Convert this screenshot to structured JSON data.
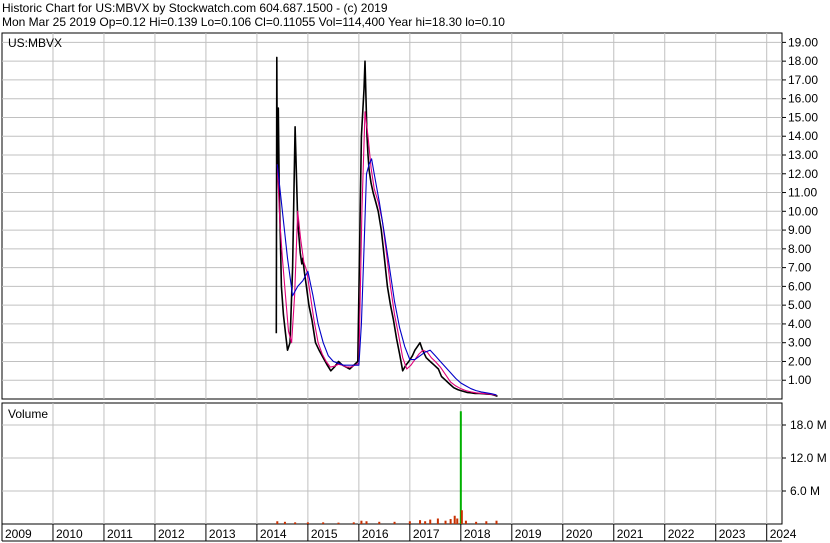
{
  "header": {
    "line1": "Historic Chart for US:MBVX by Stockwatch.com 604.687.1500 - (c) 2019",
    "line2": "Mon Mar 25 2019   Op=0.12  Hi=0.139  Lo=0.106  Cl=0.11055  Vol=114,400  Year hi=18.30  lo=0.10"
  },
  "chart_data": [
    {
      "type": "line",
      "title": "US:MBVX",
      "grid": true,
      "ylim": [
        0,
        19.5
      ],
      "y_ticks": [
        "1.00",
        "2.00",
        "3.00",
        "4.00",
        "5.00",
        "6.00",
        "7.00",
        "8.00",
        "9.00",
        "10.00",
        "11.00",
        "12.00",
        "13.00",
        "14.00",
        "15.00",
        "16.00",
        "17.00",
        "18.00",
        "19.00"
      ],
      "x_ticks": [
        "2009",
        "2010",
        "2011",
        "2012",
        "2013",
        "2014",
        "2015",
        "2016",
        "2017",
        "2018",
        "2019",
        "2020",
        "2021",
        "2022",
        "2023",
        "2024"
      ],
      "xlim": [
        2009.0,
        2024.3
      ],
      "colors": {
        "price": "#000000",
        "short_ma": "#e0007a",
        "long_ma": "#0000c8",
        "grid": "#c0c0c0"
      },
      "series": [
        {
          "key": "price",
          "x": [
            2014.38,
            2014.39,
            2014.4,
            2014.42,
            2014.44,
            2014.46,
            2014.48,
            2014.52,
            2014.56,
            2014.6,
            2014.65,
            2014.7,
            2014.75,
            2014.8,
            2014.85,
            2014.88,
            2014.9,
            2014.93,
            2014.97,
            2015.02,
            2015.08,
            2015.15,
            2015.22,
            2015.3,
            2015.38,
            2015.45,
            2015.52,
            2015.6,
            2015.68,
            2015.75,
            2015.82,
            2015.9,
            2015.98,
            2016.05,
            2016.1,
            2016.12,
            2016.14,
            2016.16,
            2016.18,
            2016.2,
            2016.24,
            2016.28,
            2016.33,
            2016.38,
            2016.44,
            2016.5,
            2016.56,
            2016.62,
            2016.68,
            2016.74,
            2016.8,
            2016.86,
            2016.92,
            2016.98,
            2017.05,
            2017.1,
            2017.15,
            2017.2,
            2017.25,
            2017.32,
            2017.4,
            2017.48,
            2017.56,
            2017.62,
            2017.7,
            2017.78,
            2017.86,
            2017.94,
            2018.0,
            2018.06,
            2018.12,
            2018.2,
            2018.28,
            2018.36,
            2018.44,
            2018.52,
            2018.6,
            2018.66,
            2018.72
          ],
          "y": [
            3.5,
            18.2,
            12.0,
            15.5,
            11.0,
            8.5,
            6.0,
            4.5,
            3.5,
            2.6,
            3.0,
            7.0,
            14.5,
            9.5,
            7.8,
            7.2,
            7.5,
            6.8,
            6.0,
            5.0,
            4.2,
            3.0,
            2.6,
            2.2,
            1.8,
            1.5,
            1.7,
            2.0,
            1.8,
            1.7,
            1.6,
            1.8,
            2.0,
            14.0,
            16.5,
            18.0,
            16.0,
            14.0,
            13.0,
            12.2,
            11.5,
            11.0,
            10.5,
            10.0,
            9.0,
            7.5,
            6.0,
            5.0,
            4.2,
            3.2,
            2.4,
            1.5,
            1.8,
            2.0,
            2.3,
            2.6,
            2.8,
            3.0,
            2.6,
            2.2,
            2.0,
            1.8,
            1.6,
            1.2,
            1.0,
            0.8,
            0.6,
            0.5,
            0.45,
            0.4,
            0.35,
            0.33,
            0.3,
            0.3,
            0.28,
            0.26,
            0.25,
            0.2,
            0.15
          ]
        },
        {
          "key": "short_ma",
          "x": [
            2014.4,
            2014.45,
            2014.5,
            2014.56,
            2014.62,
            2014.68,
            2014.74,
            2014.8,
            2014.86,
            2014.92,
            2014.98,
            2015.05,
            2015.12,
            2015.2,
            2015.28,
            2015.36,
            2015.44,
            2015.52,
            2015.6,
            2015.68,
            2015.76,
            2015.84,
            2015.92,
            2016.0,
            2016.06,
            2016.12,
            2016.18,
            2016.24,
            2016.3,
            2016.38,
            2016.46,
            2016.54,
            2016.62,
            2016.7,
            2016.78,
            2016.86,
            2016.94,
            2017.02,
            2017.1,
            2017.18,
            2017.26,
            2017.34,
            2017.42,
            2017.5,
            2017.6,
            2017.7,
            2017.8,
            2017.9,
            2018.0,
            2018.1,
            2018.2,
            2018.3,
            2018.4,
            2018.5,
            2018.6,
            2018.7
          ],
          "y": [
            12.5,
            9.5,
            7.5,
            5.5,
            3.6,
            3.0,
            5.5,
            10.0,
            8.5,
            7.3,
            6.8,
            5.5,
            4.2,
            3.0,
            2.4,
            2.0,
            1.7,
            1.75,
            1.85,
            1.8,
            1.7,
            1.7,
            1.8,
            1.9,
            10.0,
            15.3,
            14.0,
            12.3,
            11.2,
            10.5,
            9.5,
            7.8,
            6.0,
            4.5,
            3.4,
            2.2,
            1.6,
            1.8,
            2.1,
            2.4,
            2.6,
            2.5,
            2.2,
            2.0,
            1.7,
            1.3,
            0.9,
            0.7,
            0.55,
            0.45,
            0.38,
            0.33,
            0.3,
            0.28,
            0.25,
            0.2
          ]
        },
        {
          "key": "long_ma",
          "x": [
            2014.4,
            2014.5,
            2014.6,
            2014.7,
            2014.8,
            2014.9,
            2015.0,
            2015.1,
            2015.2,
            2015.3,
            2015.4,
            2015.5,
            2015.6,
            2015.7,
            2015.8,
            2015.9,
            2016.0,
            2016.05,
            2016.1,
            2016.15,
            2016.2,
            2016.25,
            2016.3,
            2016.4,
            2016.5,
            2016.6,
            2016.7,
            2016.8,
            2016.9,
            2017.0,
            2017.1,
            2017.2,
            2017.3,
            2017.4,
            2017.5,
            2017.6,
            2017.7,
            2017.8,
            2017.9,
            2018.0,
            2018.1,
            2018.2,
            2018.3,
            2018.4,
            2018.5,
            2018.6,
            2018.7
          ],
          "y": [
            12.5,
            10.0,
            7.5,
            5.5,
            6.0,
            6.3,
            6.8,
            5.5,
            4.0,
            3.0,
            2.3,
            2.0,
            1.9,
            1.8,
            1.8,
            1.8,
            1.8,
            4.0,
            8.0,
            12.0,
            12.5,
            12.8,
            12.0,
            10.5,
            8.8,
            7.0,
            5.2,
            3.8,
            2.8,
            2.1,
            2.1,
            2.3,
            2.5,
            2.6,
            2.3,
            2.0,
            1.7,
            1.4,
            1.1,
            0.85,
            0.7,
            0.55,
            0.45,
            0.38,
            0.33,
            0.28,
            0.22
          ]
        }
      ]
    },
    {
      "type": "bar",
      "title": "Volume",
      "grid": true,
      "ylim": [
        0,
        22
      ],
      "y_ticks": [
        "6.0 M",
        "12.0 M",
        "18.0 M"
      ],
      "colors": {
        "spike": "#00b000",
        "small": "#c83000"
      },
      "x": [
        2014.4,
        2014.55,
        2014.75,
        2015.0,
        2015.3,
        2015.6,
        2015.9,
        2016.05,
        2016.15,
        2016.4,
        2016.7,
        2017.0,
        2017.2,
        2017.3,
        2017.4,
        2017.55,
        2017.7,
        2017.8,
        2017.88,
        2017.93,
        2018.0,
        2018.02,
        2018.1,
        2018.3,
        2018.5,
        2018.7
      ],
      "values": [
        0.5,
        0.4,
        0.3,
        0.3,
        0.3,
        0.25,
        0.3,
        0.6,
        0.5,
        0.4,
        0.4,
        0.5,
        0.7,
        0.5,
        0.8,
        1.0,
        0.6,
        0.9,
        1.5,
        1.0,
        20.5,
        2.5,
        0.6,
        0.4,
        0.5,
        0.6
      ]
    }
  ]
}
